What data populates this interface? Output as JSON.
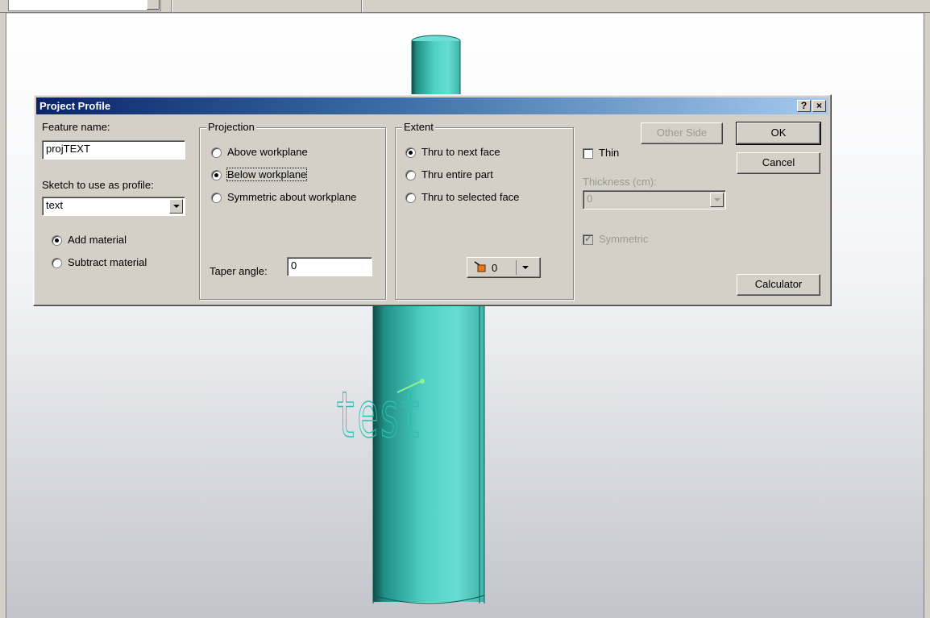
{
  "toolbar": {
    "combo_value": ""
  },
  "viewport": {
    "sketch_text": "test",
    "cylinder_color": "#5fd5c9",
    "cylinder_dark": "#0f6f66",
    "sketch_color": "#3bc1b6"
  },
  "dialog": {
    "title": "Project Profile",
    "help_label": "?",
    "close_label": "×",
    "feature_name_label": "Feature name:",
    "feature_name_value": "projTEXT",
    "sketch_label": "Sketch to use as profile:",
    "sketch_value": "text",
    "add_material_label": "Add material",
    "subtract_material_label": "Subtract material",
    "projection": {
      "title": "Projection",
      "options": [
        "Above workplane",
        "Below workplane",
        "Symmetric about workplane"
      ],
      "selected": "Below workplane",
      "taper_label": "Taper angle:",
      "taper_value": "0"
    },
    "extent": {
      "title": "Extent",
      "options": [
        "Thru to next face",
        "Thru entire part",
        "Thru to selected face"
      ],
      "selected": "Thru to next face",
      "face_count": "0"
    },
    "other_side_label": "Other Side",
    "thin_label": "Thin",
    "thickness_label": "Thickness (cm):",
    "thickness_value": "0",
    "symmetric_label": "Symmetric",
    "ok_label": "OK",
    "cancel_label": "Cancel",
    "calculator_label": "Calculator"
  }
}
